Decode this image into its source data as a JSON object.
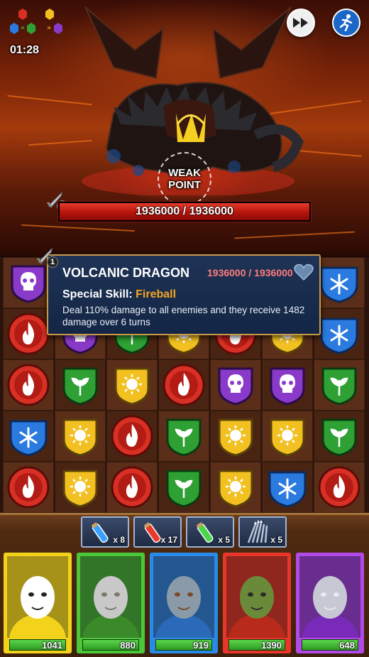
{
  "battle": {
    "timer": "01:28",
    "weak_point_line1": "WEAK",
    "weak_point_line2": "POINT",
    "boss_hp_text": "1936000 / 1936000",
    "boss_hp_fraction": 1.0,
    "boss_sword_level": "1"
  },
  "controls": {
    "fast_forward_icon": "fast-forward-icon",
    "retreat_icon": "running-man-icon"
  },
  "tooltip": {
    "badge_level": "1",
    "name": "VOLCANIC DRAGON",
    "hp_text": "1936000 / 1936000",
    "skill_prefix": "Special Skill: ",
    "skill_name": "Fireball",
    "description": "Deal 110% damage to all enemies and they receive 1482 damage over 6 turns"
  },
  "board": {
    "rows": [
      [
        "purple",
        "blue",
        "green",
        "yellow",
        "red",
        "yellow",
        "blue"
      ],
      [
        "red",
        "purple",
        "green",
        "yellow",
        "red",
        "yellow",
        "blue"
      ],
      [
        "red",
        "green",
        "yellow",
        "red",
        "purple",
        "purple",
        "green"
      ],
      [
        "blue",
        "yellow",
        "red",
        "green",
        "yellow",
        "yellow",
        "green"
      ],
      [
        "red",
        "yellow",
        "red",
        "green",
        "yellow",
        "blue",
        "red"
      ]
    ]
  },
  "items": [
    {
      "name": "mana-potion",
      "count": "x 8",
      "color": "#3aa0ff"
    },
    {
      "name": "health-potion",
      "count": "x 17",
      "color": "#e83a2a"
    },
    {
      "name": "antidote-potion",
      "count": "x 5",
      "color": "#4ad64a"
    },
    {
      "name": "arrows",
      "count": "x 5",
      "color": "#b8c6d8"
    }
  ],
  "heroes": [
    {
      "name": "panda",
      "hp": "1041",
      "border": "#f2d21a"
    },
    {
      "name": "druid",
      "hp": "880",
      "border": "#4ac83a"
    },
    {
      "name": "knight",
      "hp": "919",
      "border": "#2a8ae8"
    },
    {
      "name": "orc",
      "hp": "1390",
      "border": "#e8362a"
    },
    {
      "name": "sorcerer",
      "hp": "648",
      "border": "#b24ae8"
    }
  ],
  "colors": {
    "red": "#d83024",
    "blue": "#2a7ae0",
    "green": "#2ea034",
    "yellow": "#f2c020",
    "purple": "#8a3ac8"
  }
}
